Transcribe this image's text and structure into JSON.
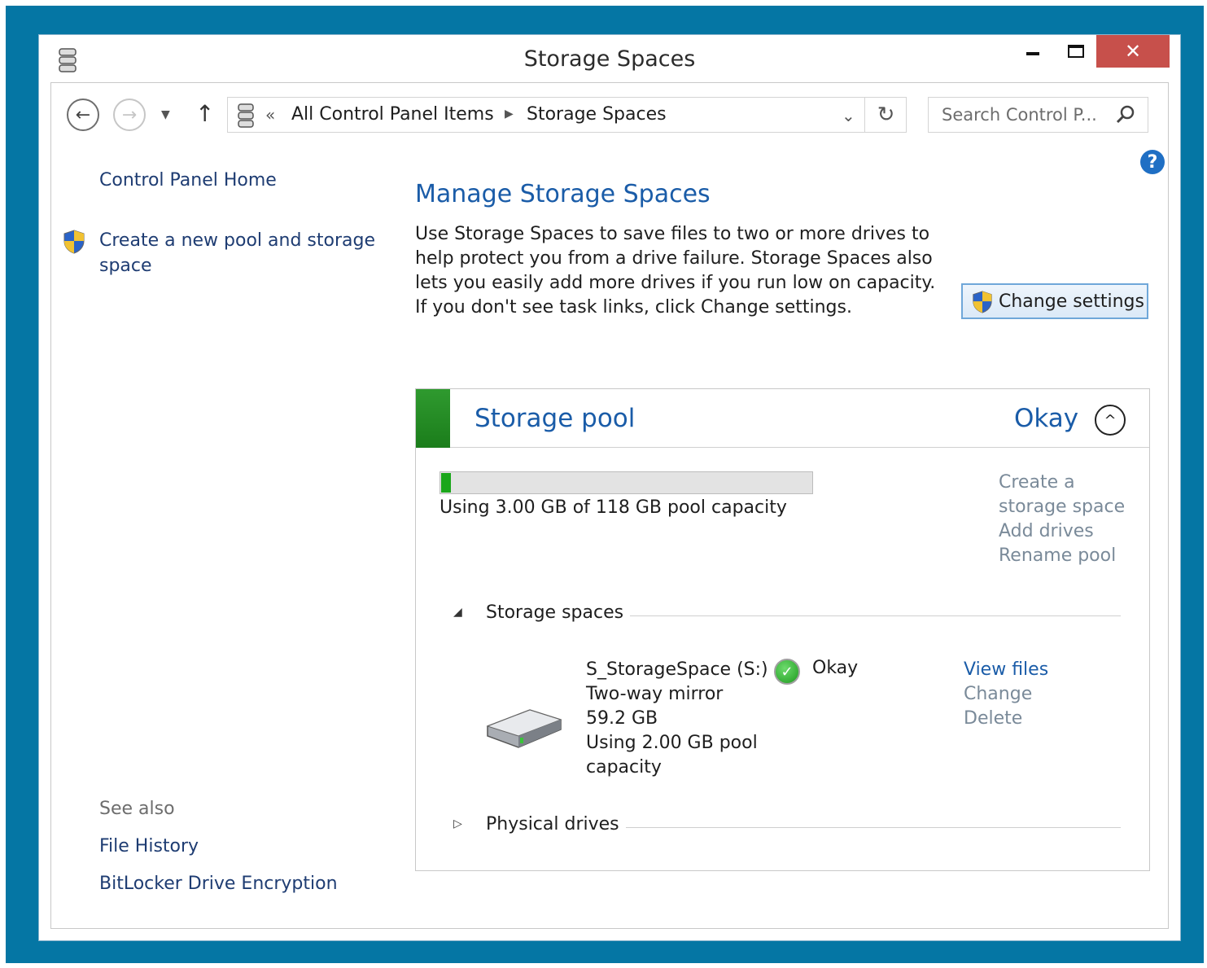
{
  "window": {
    "title": "Storage Spaces",
    "close_glyph": "✕"
  },
  "address": {
    "chevrons": "«",
    "crumb1": "All Control Panel Items",
    "crumb_sep": "▶",
    "crumb2": "Storage Spaces",
    "dropdown_glyph": "⌄",
    "refresh_glyph": "↻"
  },
  "nav": {
    "back_glyph": "←",
    "forward_glyph": "→",
    "dropdown_glyph": "▼",
    "up_glyph": "↑"
  },
  "search": {
    "placeholder": "Search Control P..."
  },
  "help": {
    "glyph": "?"
  },
  "left": {
    "home": "Control Panel Home",
    "create": "Create a new pool and storage space",
    "see_also": "See also",
    "file_history": "File History",
    "bitlocker": "BitLocker Drive Encryption"
  },
  "main": {
    "title": "Manage Storage Spaces",
    "description": "Use Storage Spaces to save files to two or more drives to help protect you from a drive failure. Storage Spaces also lets you easily add more drives if you run low on capacity. If you don't see task links, click Change settings.",
    "change_settings": "Change settings"
  },
  "pool": {
    "title": "Storage pool",
    "status": "Okay",
    "collapse_glyph": "^",
    "usage_fraction": 0.0254,
    "usage_text": "Using 3.00 GB of 118 GB pool capacity",
    "actions": {
      "create_line1": "Create a",
      "create_line2": "storage space",
      "add_drives": "Add drives",
      "rename": "Rename pool"
    },
    "spaces_section": {
      "label": "Storage spaces",
      "glyph": "◢"
    },
    "drives_section": {
      "label": "Physical drives",
      "glyph": "▷"
    },
    "space": {
      "name": "S_StorageSpace (S:)",
      "type": "Two-way mirror",
      "size": "59.2 GB",
      "usage": "Using 2.00 GB pool capacity",
      "status": "Okay",
      "check_glyph": "✓",
      "actions": {
        "view_files": "View files",
        "change": "Change",
        "delete": "Delete"
      }
    }
  },
  "colors": {
    "accent": "#1a5ca8",
    "desktop": "#0576a4",
    "pool_ok": "#1b7d1b",
    "close": "#c7504b"
  }
}
